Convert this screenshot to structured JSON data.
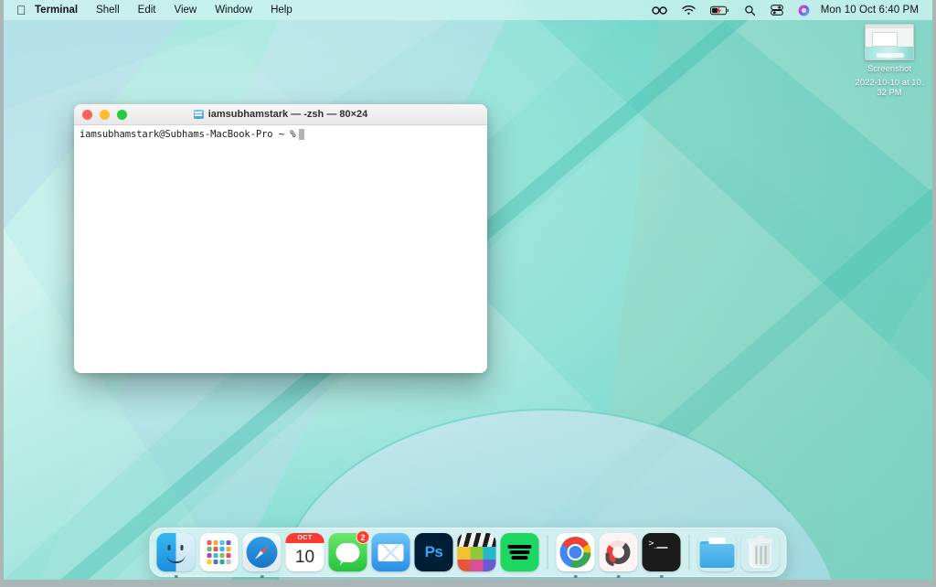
{
  "menubar": {
    "apple_icon": "apple-logo",
    "app_name": "Terminal",
    "menus": [
      "Terminal",
      "Shell",
      "Edit",
      "View",
      "Window",
      "Help"
    ],
    "status_icons": [
      "infinity-icon",
      "wifi-icon",
      "battery-charging-icon",
      "spotlight-search-icon",
      "control-center-icon",
      "siri-icon"
    ],
    "clock": "Mon 10 Oct  6:40 PM"
  },
  "desktop": {
    "icon": {
      "name": "screenshot-file-icon",
      "label_line1": "Screenshot",
      "label_line2": "2022-10-10 at 10.32 PM"
    }
  },
  "terminal": {
    "title": "iamsubhamstark — -zsh — 80×24",
    "title_icon": "terminal-folder-icon",
    "traffic_lights": [
      "close",
      "minimize",
      "zoom"
    ],
    "prompt": "iamsubhamstark@Subhams-MacBook-Pro ~ %",
    "cursor": "block-cursor"
  },
  "dock": {
    "items": [
      {
        "name": "finder",
        "label": "Finder",
        "running": true
      },
      {
        "name": "launchpad",
        "label": "Launchpad",
        "running": false
      },
      {
        "name": "safari",
        "label": "Safari",
        "running": true
      },
      {
        "name": "calendar",
        "label": "Calendar",
        "month": "OCT",
        "day": "10",
        "running": false
      },
      {
        "name": "messages",
        "label": "Messages",
        "badge": "2",
        "running": false
      },
      {
        "name": "mail",
        "label": "Mail",
        "running": false
      },
      {
        "name": "photoshop",
        "label": "Photoshop",
        "glyph": "Ps",
        "running": false
      },
      {
        "name": "final-cut-pro",
        "label": "Final Cut Pro",
        "running": false
      },
      {
        "name": "spotify",
        "label": "Spotify",
        "running": false
      },
      {
        "name": "chrome",
        "label": "Google Chrome",
        "running": true
      },
      {
        "name": "cleanmymac",
        "label": "CleanMyMac",
        "running": true
      },
      {
        "name": "terminal",
        "label": "Terminal",
        "glyph": ">_",
        "running": true
      },
      {
        "name": "downloads-folder",
        "label": "Downloads",
        "running": false
      },
      {
        "name": "trash",
        "label": "Trash",
        "running": false
      }
    ]
  },
  "colors": {
    "wallpaper_teal": "#6fd6ca",
    "wallpaper_light": "#cdf3ef",
    "wallpaper_blue": "#bfe0ec",
    "wallpaper_green": "#9fd9c6",
    "accent_red": "#ff5f57",
    "accent_yellow": "#febc2e",
    "accent_green": "#28c840",
    "badge_red": "#ff3b30"
  }
}
